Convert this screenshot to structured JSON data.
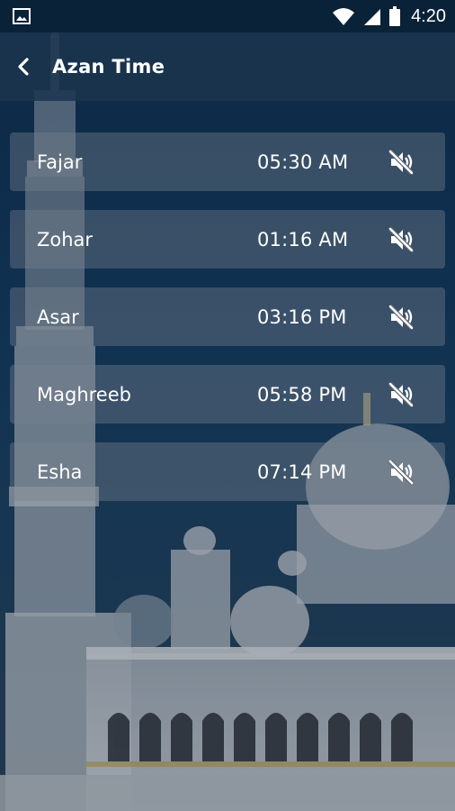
{
  "status_bar": {
    "time": "4:20",
    "icons": [
      "gallery-icon",
      "wifi-icon",
      "cell-signal-icon",
      "battery-icon"
    ]
  },
  "app_bar": {
    "back_icon": "chevron-left-icon",
    "title": "Azan Time"
  },
  "prayers": [
    {
      "name": "Fajar",
      "time": "05:30 AM",
      "sound_icon": "speaker-muted-icon"
    },
    {
      "name": "Zohar",
      "time": "01:16 AM",
      "sound_icon": "speaker-muted-icon"
    },
    {
      "name": "Asar",
      "time": "03:16 PM",
      "sound_icon": "speaker-muted-icon"
    },
    {
      "name": "Maghreeb",
      "time": "05:58 PM",
      "sound_icon": "speaker-muted-icon"
    },
    {
      "name": "Esha",
      "time": "07:14 PM",
      "sound_icon": "speaker-muted-icon"
    }
  ],
  "colors": {
    "status_bar": "#0a2238",
    "app_bar": "#1c344e",
    "row_background": "#78828e",
    "text": "#ffffff"
  }
}
